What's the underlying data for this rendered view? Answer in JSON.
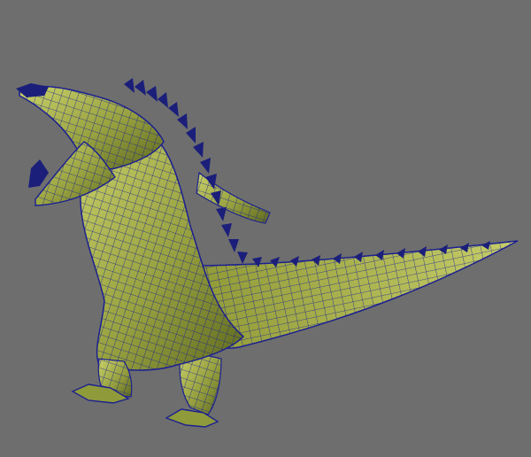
{
  "viewport": {
    "background_color": "#6e6e6e",
    "wireframe_color": "#1a1f8c",
    "surface_color": "#8f9a3a",
    "surface_highlight": "#c7cf62",
    "spike_color": "#1b1f7a"
  },
  "model": {
    "display_mode": "wireframe-on-shaded",
    "icon": "crocodile-model-icon"
  }
}
